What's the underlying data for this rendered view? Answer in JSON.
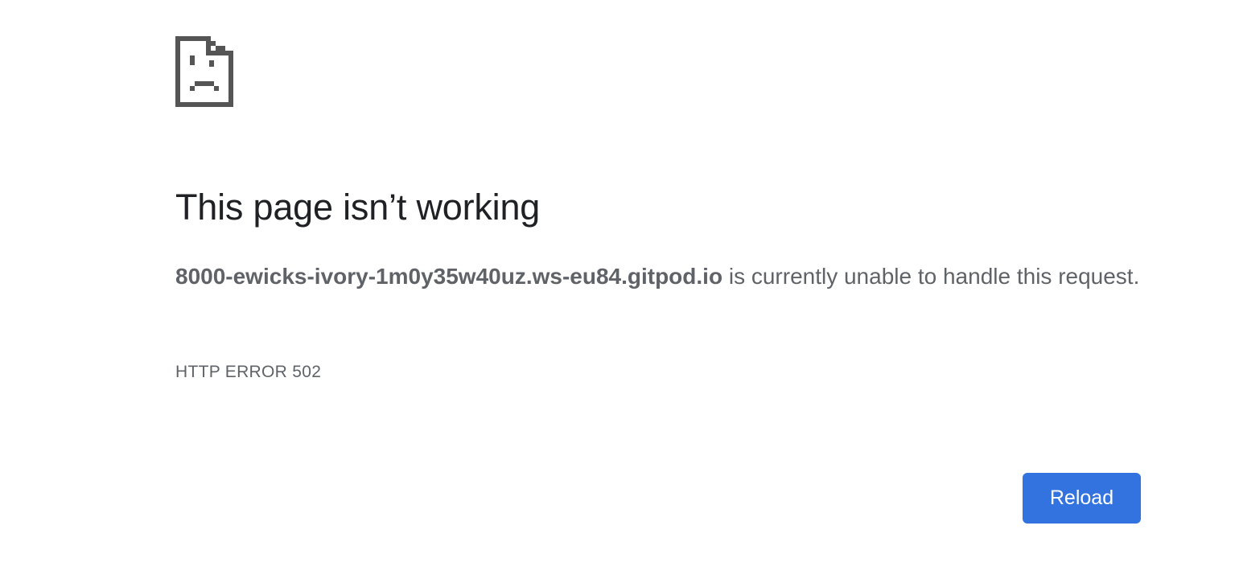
{
  "error_page": {
    "icon": "sad-page-icon",
    "title": "This page isn’t working",
    "host": "8000-ewicks-ivory-1m0y35w40uz.ws-eu84.gitpod.io",
    "message_suffix": " is currently unable to handle this request.",
    "error_code": "HTTP ERROR 502",
    "reload_label": "Reload"
  },
  "colors": {
    "title": "#202124",
    "text": "#5f6368",
    "button": "#3273df",
    "button_text": "#ffffff",
    "icon": "#555555"
  }
}
